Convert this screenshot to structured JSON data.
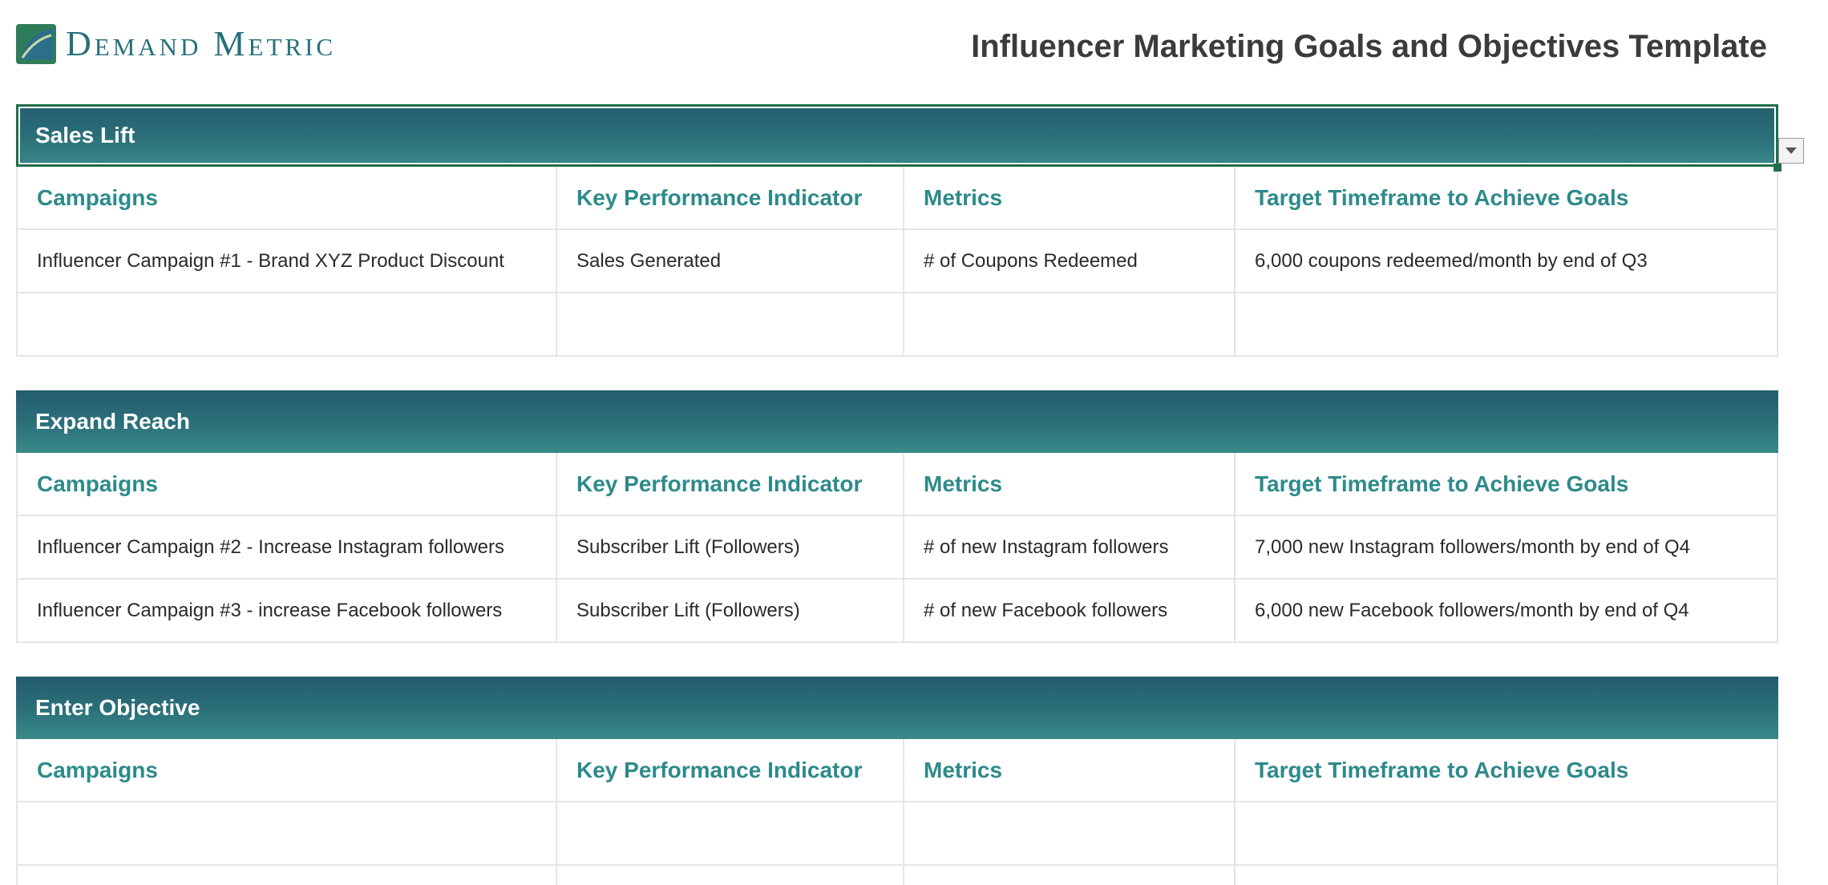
{
  "header": {
    "logo_text": "Demand Metric",
    "title": "Influencer Marketing Goals and Objectives Template"
  },
  "sections": [
    {
      "title": "Sales Lift",
      "columns": [
        "Campaigns",
        "Key Performance Indicator",
        "Metrics",
        "Target Timeframe to Achieve Goals"
      ],
      "rows": [
        [
          "Influencer Campaign #1 - Brand XYZ Product Discount",
          "Sales Generated",
          "# of Coupons Redeemed",
          "6,000 coupons redeemed/month by end of Q3"
        ],
        [
          "",
          "",
          "",
          ""
        ]
      ]
    },
    {
      "title": "Expand Reach",
      "columns": [
        "Campaigns",
        "Key Performance Indicator",
        "Metrics",
        "Target Timeframe to Achieve Goals"
      ],
      "rows": [
        [
          "Influencer Campaign #2 -  Increase Instagram followers",
          "Subscriber Lift (Followers)",
          "# of new Instagram followers",
          "7,000 new Instagram followers/month by end of Q4"
        ],
        [
          "Influencer Campaign #3 - increase Facebook followers",
          "Subscriber Lift (Followers)",
          "# of new Facebook followers",
          "6,000 new Facebook followers/month by end of Q4"
        ]
      ]
    },
    {
      "title": "Enter Objective",
      "columns": [
        "Campaigns",
        "Key Performance Indicator",
        "Metrics",
        "Target Timeframe to Achieve Goals"
      ],
      "rows": [
        [
          "",
          "",
          "",
          ""
        ],
        [
          "",
          "",
          "",
          ""
        ]
      ]
    }
  ],
  "colors": {
    "banner": "#2a6e78",
    "header_text": "#2e8a8a",
    "logo": "#24707a"
  },
  "icons": {
    "dropdown": "chevron-down-icon",
    "logo": "demand-metric-logo-icon"
  }
}
